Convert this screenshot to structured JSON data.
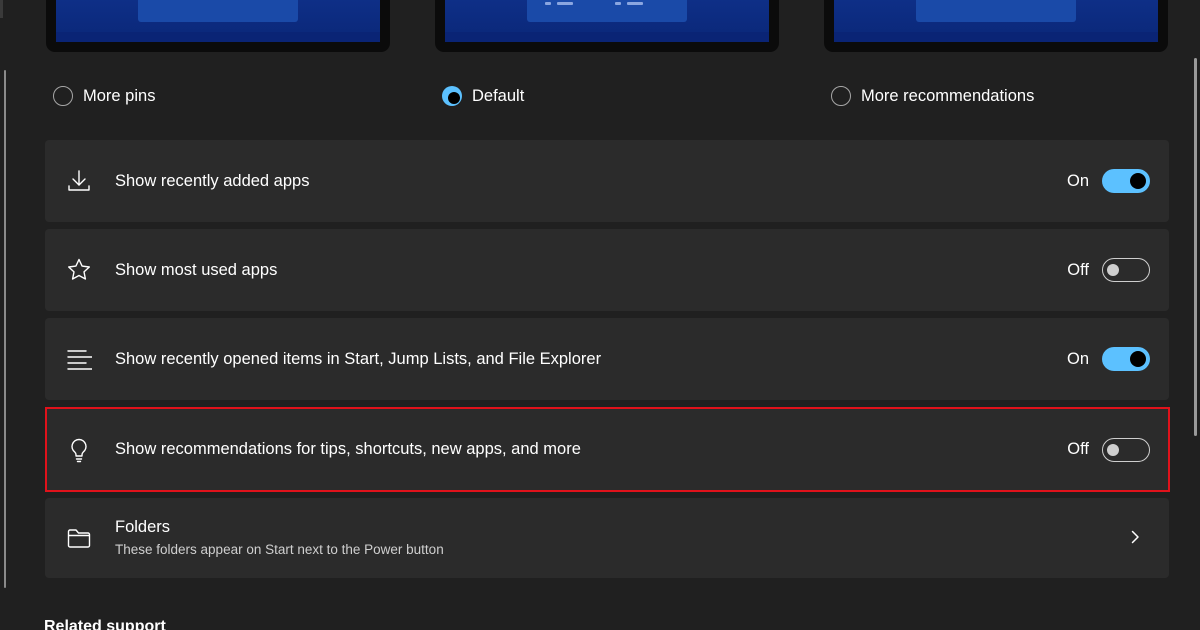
{
  "layouts": {
    "options": [
      {
        "label": "More pins",
        "selected": false
      },
      {
        "label": "Default",
        "selected": true
      },
      {
        "label": "More recommendations",
        "selected": false
      }
    ]
  },
  "settings": [
    {
      "icon": "download-icon",
      "label": "Show recently added apps",
      "state": "On",
      "on": true
    },
    {
      "icon": "star-icon",
      "label": "Show most used apps",
      "state": "Off",
      "on": false
    },
    {
      "icon": "list-icon",
      "label": "Show recently opened items in Start, Jump Lists, and File Explorer",
      "state": "On",
      "on": true
    },
    {
      "icon": "lightbulb-icon",
      "label": "Show recommendations for tips, shortcuts, new apps, and more",
      "state": "Off",
      "on": false
    }
  ],
  "folders": {
    "icon": "folder-icon",
    "title": "Folders",
    "subtitle": "These folders appear on Start next to the Power button"
  },
  "related_support": "Related support",
  "colors": {
    "accent": "#5cc1ff",
    "highlight": "#e0121b",
    "card": "#2b2b2b",
    "background": "#202020"
  }
}
